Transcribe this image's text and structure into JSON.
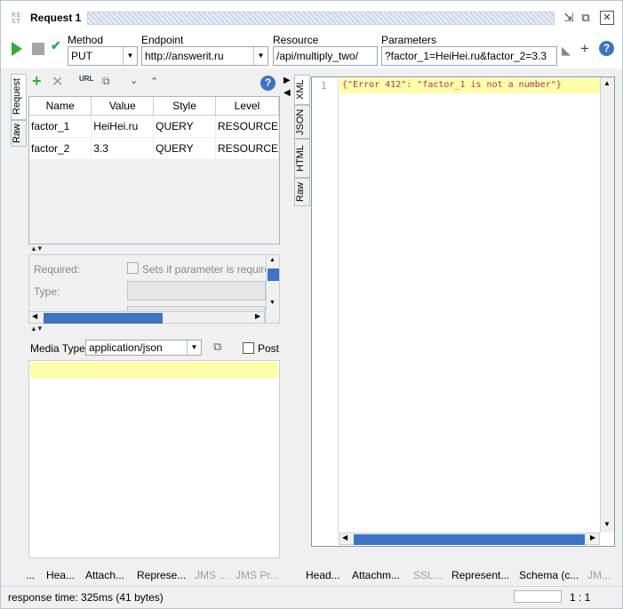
{
  "window": {
    "logo": "REST",
    "title": "Request 1",
    "controls": [
      "restore-icon",
      "detach-icon",
      "close-icon"
    ]
  },
  "toolbar": {
    "method_label": "Method",
    "method_value": "PUT",
    "endpoint_label": "Endpoint",
    "endpoint_value": "http://answerit.ru",
    "resource_label": "Resource",
    "resource_value": "/api/multiply_two/",
    "parameters_label": "Parameters",
    "parameters_value": "?factor_1=HeiHei.ru&factor_2=3.3",
    "help": "?"
  },
  "request_panel": {
    "side_tabs": [
      "Request",
      "Raw"
    ],
    "help": "?",
    "columns": [
      "Name",
      "Value",
      "Style",
      "Level"
    ],
    "rows": [
      {
        "name": "factor_1",
        "value": "HeiHei.ru",
        "style": "QUERY",
        "level": "RESOURCE"
      },
      {
        "name": "factor_2",
        "value": "3.3",
        "style": "QUERY",
        "level": "RESOURCE"
      }
    ],
    "details": {
      "required_label": "Required:",
      "required_hint": "Sets if parameter is require",
      "type_label": "Type:"
    },
    "media_type_label": "Media Type",
    "media_type_value": "application/json",
    "post_label": "Post"
  },
  "response_panel": {
    "side_tabs": [
      "XML",
      "JSON",
      "HTML",
      "Raw"
    ],
    "line_number": "1",
    "code": "{\"Error 412\": \"factor_1 is not a number\"}"
  },
  "bottom_tabs_left": [
    "...",
    "Hea...",
    "Attach...",
    "Represe...",
    "JMS ...",
    "JMS Pr..."
  ],
  "bottom_tabs_left_disabled": [
    false,
    false,
    false,
    false,
    true,
    true
  ],
  "bottom_tabs_right": [
    "Head...",
    "Attachm...",
    "SSL...",
    "Represent...",
    "Schema (c...",
    "JM..."
  ],
  "bottom_tabs_right_disabled": [
    false,
    false,
    true,
    false,
    false,
    true
  ],
  "status": {
    "response_time": "response time: 325ms (41 bytes)",
    "position": "1 : 1"
  },
  "colors": {
    "accent": "#3b73c9",
    "run_green": "#2fae34",
    "editor_highlight": "#ffffa8",
    "code_text": "#b0307a"
  }
}
